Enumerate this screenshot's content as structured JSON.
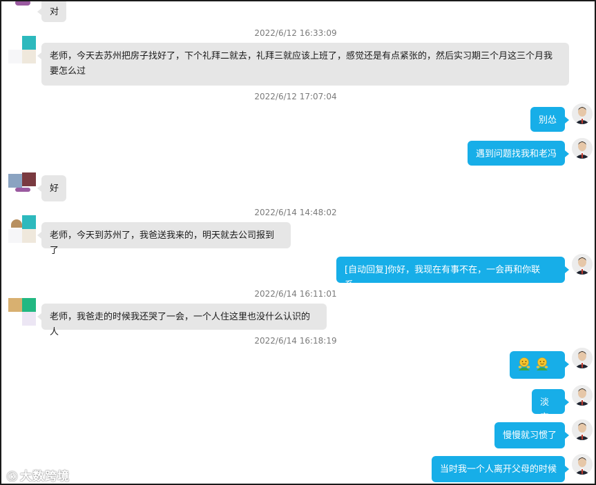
{
  "timestamps": {
    "t1": "2022/6/12 16:33:09",
    "t2": "2022/6/12 17:07:04",
    "t3": "2022/6/14 14:48:02",
    "t4": "2022/6/14 16:11:01",
    "t5": "2022/6/14 16:18:19"
  },
  "messages": {
    "m0": "对",
    "m1": "老师，今天去苏州把房子找好了，下个礼拜二就去，礼拜三就应该上班了，感觉还是有点紧张的，然后实习期三个月这三个月我要怎么过",
    "m2": "别怂",
    "m3": "遇到问题找我和老冯",
    "m4": "好",
    "m5": "老师，今天到苏州了，我爸送我来的，明天就去公司报到了",
    "m6": "[自动回复]你好，我现在有事不在，一会再和你联系。",
    "m7": "老师，我爸走的时候我还哭了一会，一个人住这里也没什么认识的人",
    "m8_icons": [
      "hug-emoji-icon",
      "hug-emoji-icon"
    ],
    "m9": "淡定",
    "m10": "慢慢就习惯了",
    "m11": "当时我一个人离开父母的时候"
  },
  "watermark": {
    "text": "大数跨境",
    "logo": "ⓚ"
  },
  "colors": {
    "incoming": "#e6e6e6",
    "outgoing": "#17aee8",
    "timestamp": "#7a7a7a"
  }
}
